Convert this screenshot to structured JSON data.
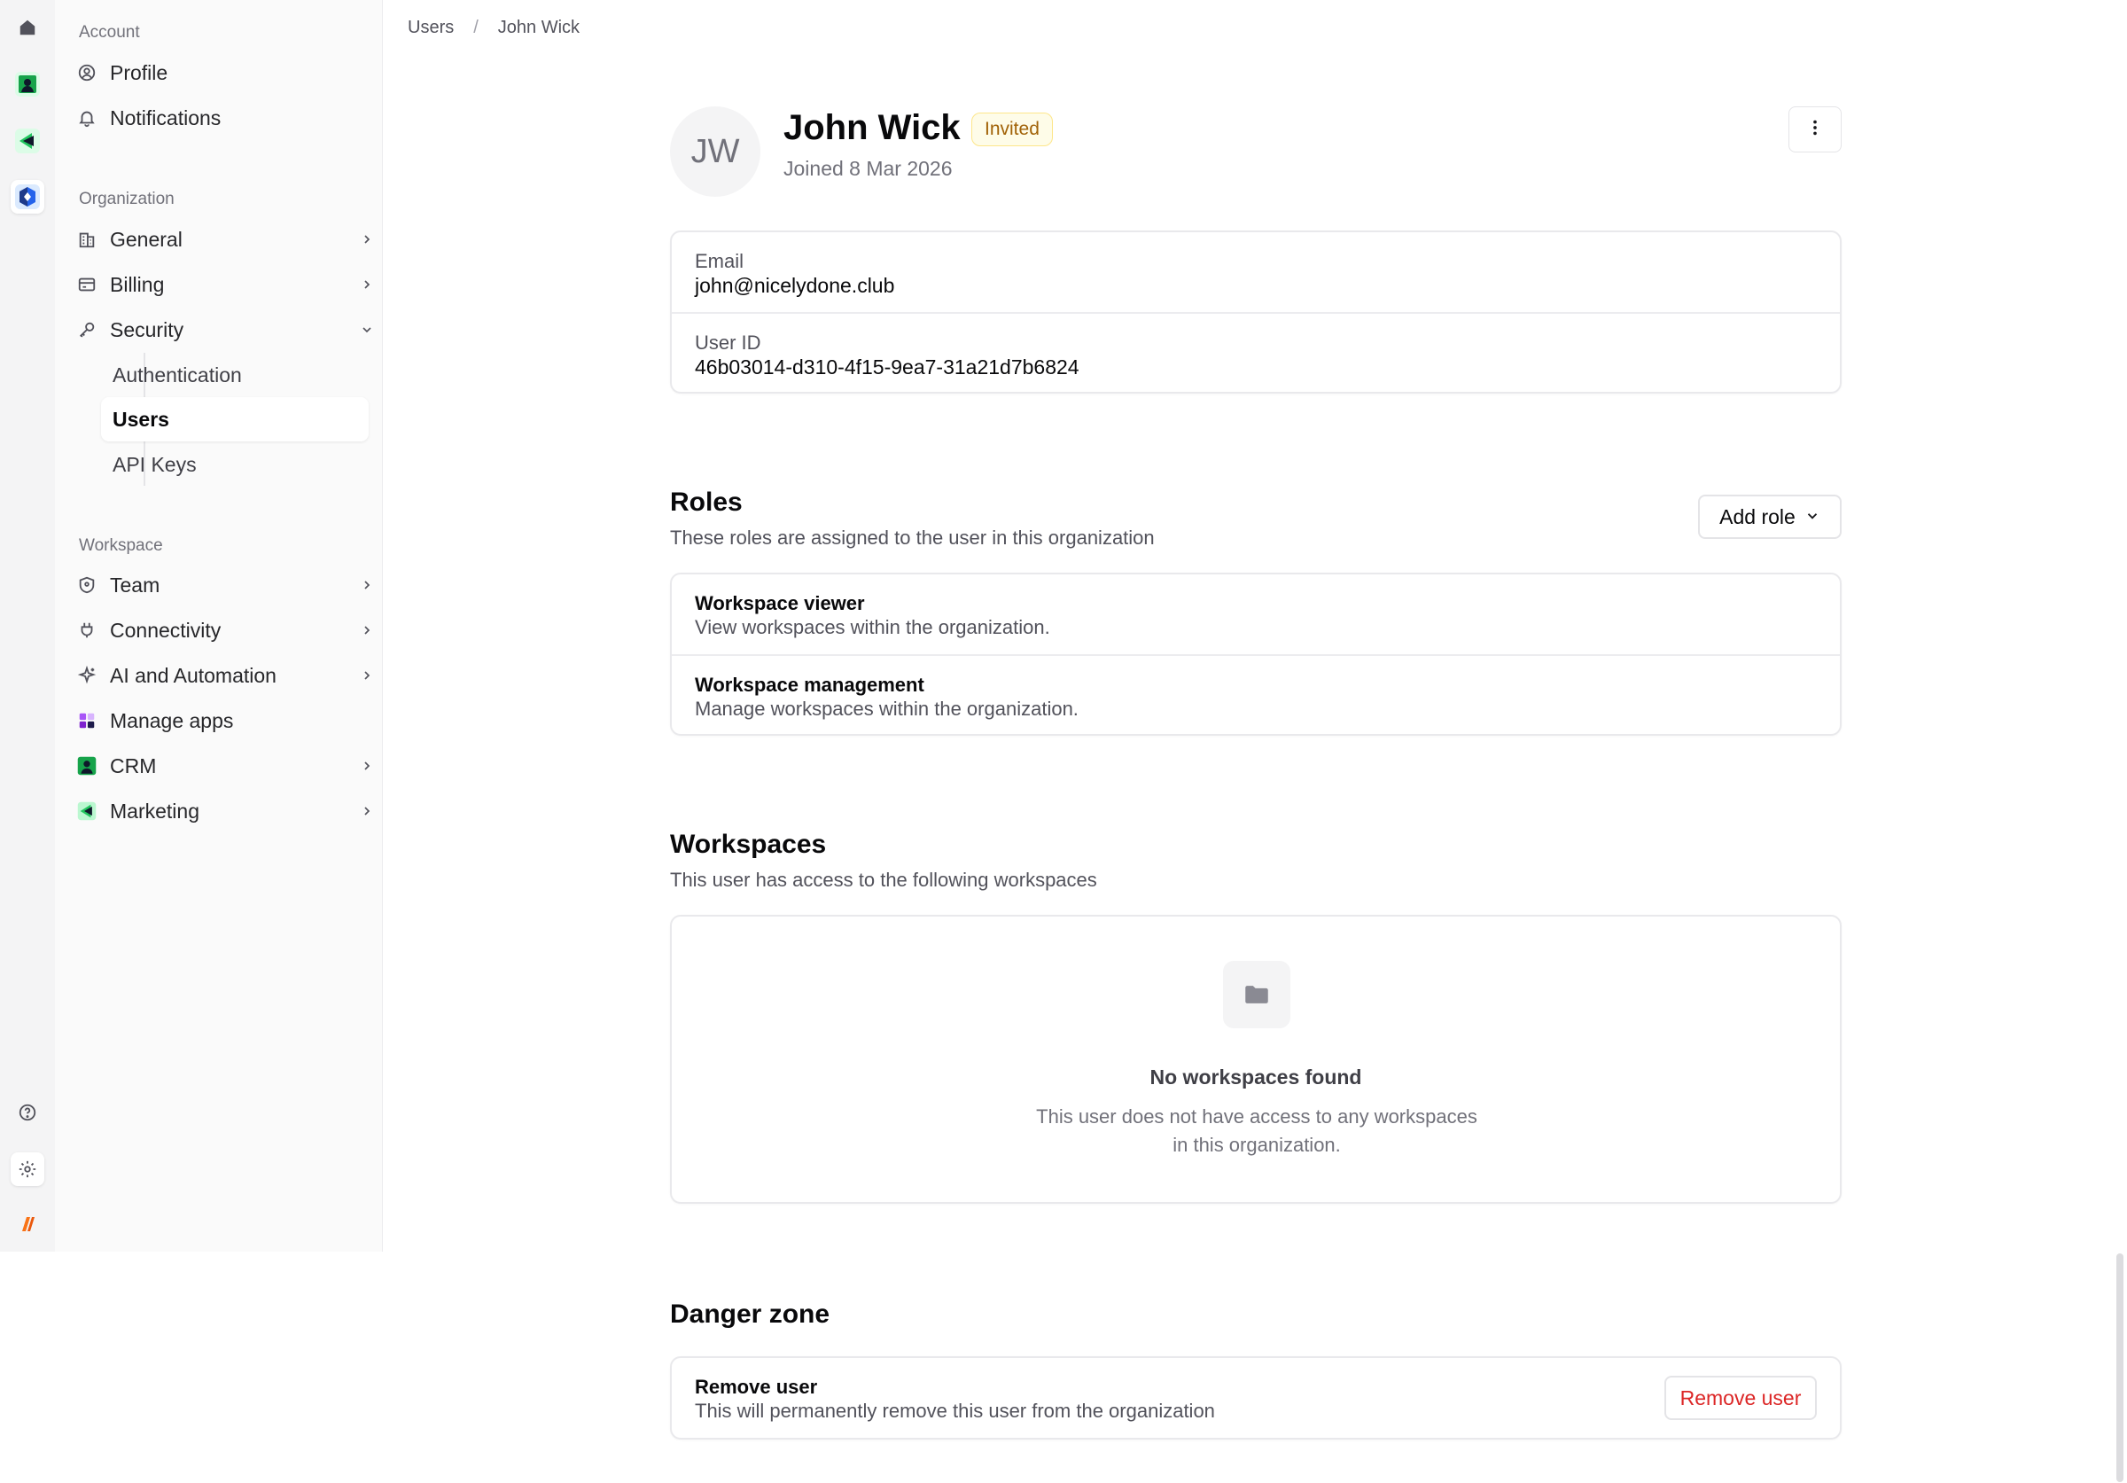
{
  "rail": {
    "colors": {
      "crm": "#16a34a",
      "marketing": "#22c55e",
      "brand_blue": "#2563eb",
      "orange": "#f97316"
    }
  },
  "sidebar": {
    "account_label": "Account",
    "account_items": [
      {
        "label": "Profile",
        "icon": "user-circle-icon"
      },
      {
        "label": "Notifications",
        "icon": "bell-icon"
      }
    ],
    "organization_label": "Organization",
    "organization_items": [
      {
        "label": "General",
        "icon": "building-icon"
      },
      {
        "label": "Billing",
        "icon": "credit-card-icon"
      },
      {
        "label": "Security",
        "icon": "key-icon"
      }
    ],
    "security_subitems": [
      {
        "label": "Authentication"
      },
      {
        "label": "Users",
        "active": true
      },
      {
        "label": "API Keys"
      }
    ],
    "workspace_label": "Workspace",
    "workspace_items": [
      {
        "label": "Team",
        "icon": "shield-icon"
      },
      {
        "label": "Connectivity",
        "icon": "plug-icon"
      },
      {
        "label": "AI and Automation",
        "icon": "sparkle-icon"
      },
      {
        "label": "Manage apps",
        "icon": "apps-grid-icon"
      },
      {
        "label": "CRM",
        "icon": "crm-logo-icon"
      },
      {
        "label": "Marketing",
        "icon": "marketing-logo-icon"
      }
    ]
  },
  "breadcrumb": {
    "parent": "Users",
    "current": "John Wick"
  },
  "user": {
    "initials": "JW",
    "name": "John Wick",
    "status": "Invited",
    "joined": "Joined 8 Mar 2026",
    "email_label": "Email",
    "email": "john@nicelydone.club",
    "id_label": "User ID",
    "id": "46b03014-d310-4f15-9ea7-31a21d7b6824"
  },
  "roles": {
    "title": "Roles",
    "subtitle": "These roles are assigned to the user in this organization",
    "add_label": "Add role",
    "items": [
      {
        "name": "Workspace viewer",
        "desc": "View workspaces within the organization."
      },
      {
        "name": "Workspace management",
        "desc": "Manage workspaces within the organization."
      }
    ]
  },
  "workspaces": {
    "title": "Workspaces",
    "subtitle": "This user has access to the following workspaces",
    "empty_title": "No workspaces found",
    "empty_desc": "This user does not have access to any workspaces in this organization."
  },
  "danger": {
    "title": "Danger zone",
    "row_title": "Remove user",
    "row_desc": "This will permanently remove this user from the organization",
    "button": "Remove user",
    "button_color": "#dc2626"
  }
}
